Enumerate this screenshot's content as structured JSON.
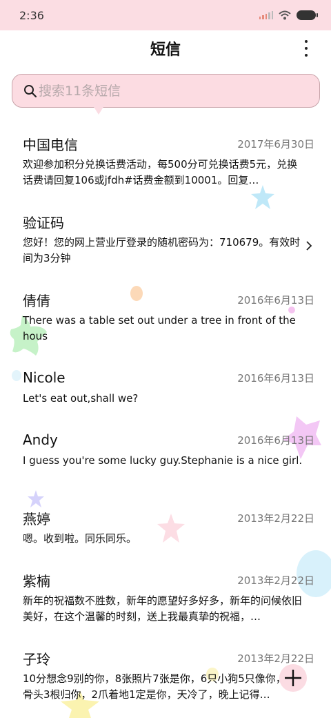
{
  "status_bar": {
    "time": "2:36"
  },
  "header": {
    "title": "短信"
  },
  "search": {
    "placeholder": "搜索11条短信"
  },
  "messages": [
    {
      "sender": "中国电信",
      "date": "2017年6月30日",
      "preview": "欢迎参加积分兑换话费活动，每500分可兑换话费5元，兑换话费请回复106或jfdh#话费金额到10001。回复…"
    },
    {
      "sender": "验证码",
      "date": "",
      "preview": "您好！您的网上营业厅登录的随机密码为：710679。有效时间为3分钟"
    },
    {
      "sender": "倩倩",
      "date": "2016年6月13日",
      "preview": "There was a table set out under a tree in front of the hous"
    },
    {
      "sender": "Nicole",
      "date": "2016年6月13日",
      "preview": "Let's eat out,shall we?"
    },
    {
      "sender": "Andy",
      "date": "2016年6月13日",
      "preview": "I guess you're some lucky guy.Stephanie is a nice girl."
    },
    {
      "sender": "燕婷",
      "date": "2013年2月22日",
      "preview": "嗯。收到啦。同乐同乐。"
    },
    {
      "sender": "紫楠",
      "date": "2013年2月22日",
      "preview": "新年的祝福数不胜数，新年的愿望好多好多，新年的问候依旧美好，在这个温馨的时刻，送上我最真挚的祝福，…"
    },
    {
      "sender": "子玲",
      "date": "2013年2月22日",
      "preview": "10分想念9别的你，8张照片7张是你，6只小狗5只像你，4根骨头3根归你，2爪着地1定是你，天冷了，晚上记得…"
    }
  ],
  "icons": {
    "more": "more-vertical-icon",
    "search": "search-icon",
    "chevron": "chevron-right-icon",
    "fab": "plus-icon"
  },
  "colors": {
    "status_bar_bg": "#fbdde3",
    "search_bg": "#fcdce2",
    "search_border": "#c8a4aa"
  }
}
